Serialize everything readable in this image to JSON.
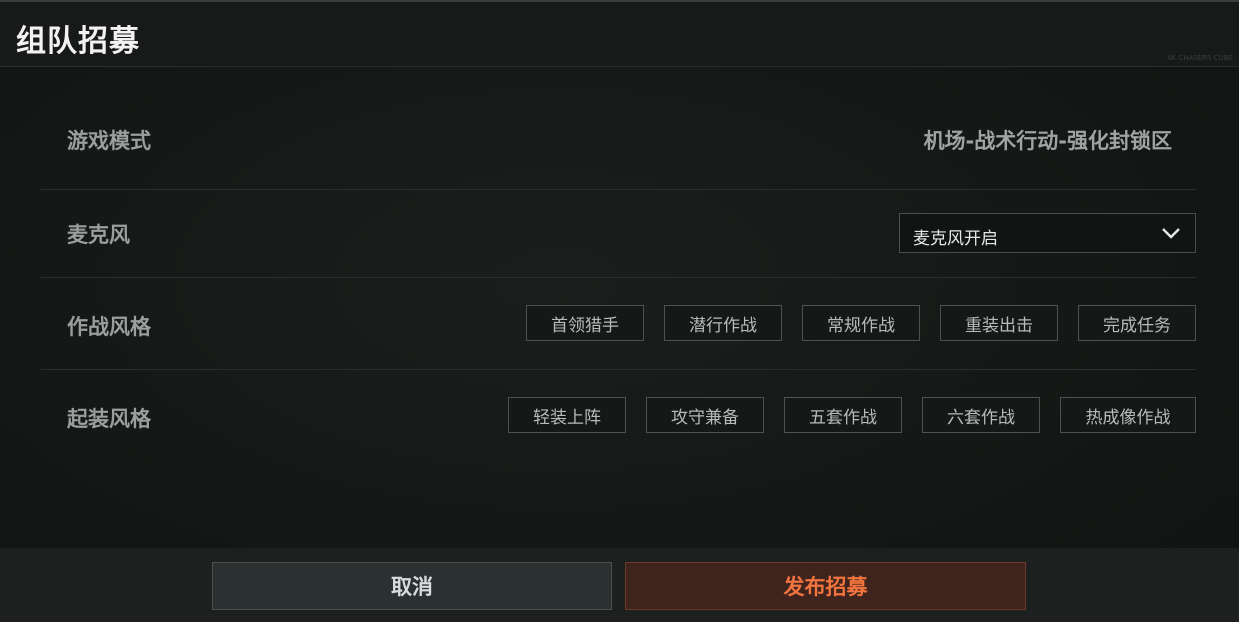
{
  "dialog": {
    "title": "组队招募",
    "watermark": "4K CHASERS CUBE"
  },
  "rows": {
    "game_mode": {
      "label": "游戏模式",
      "value": "机场-战术行动-强化封锁区"
    },
    "microphone": {
      "label": "麦克风",
      "selected": "麦克风开启",
      "icon": "chevron-down-icon"
    },
    "combat_style": {
      "label": "作战风格",
      "tags": [
        "首领猎手",
        "潜行作战",
        "常规作战",
        "重装出击",
        "完成任务"
      ]
    },
    "loadout_style": {
      "label": "起装风格",
      "tags": [
        "轻装上阵",
        "攻守兼备",
        "五套作战",
        "六套作战",
        "热成像作战"
      ]
    }
  },
  "footer": {
    "cancel_label": "取消",
    "publish_label": "发布招募"
  },
  "colors": {
    "accent": "#f2743f",
    "publish_bg": "#3f231d"
  }
}
